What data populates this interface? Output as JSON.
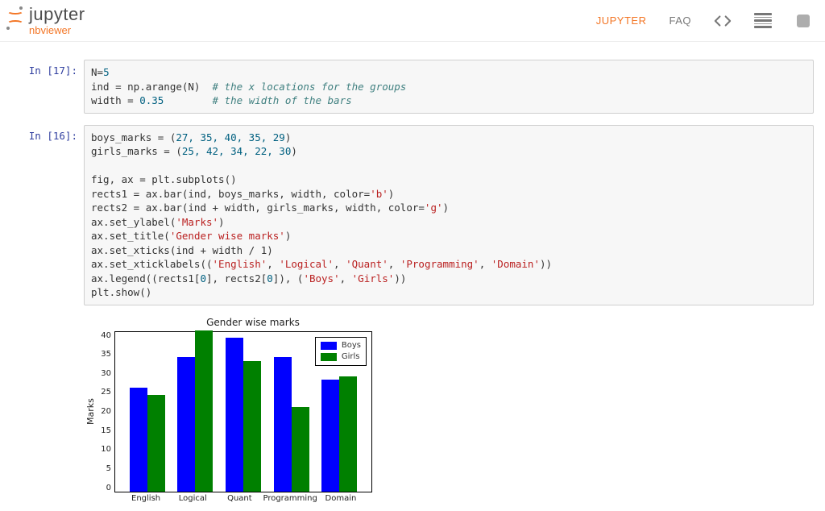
{
  "header": {
    "logo_main": "jupyter",
    "logo_sub": "nbviewer",
    "nav": {
      "jupyter": "JUPYTER",
      "faq": "FAQ"
    }
  },
  "cells": {
    "c17": {
      "prompt": "In [17]:",
      "line1_a": "N=",
      "line1_b": "5",
      "line2_a": "ind = np.arange(N)  ",
      "line2_c": "# the x locations for the groups",
      "line3_a": "width = ",
      "line3_b": "0.35",
      "line3_pad": "        ",
      "line3_c": "# the width of the bars"
    },
    "c16": {
      "prompt": "In [16]:",
      "l1": "boys_marks = (",
      "l1v": "27, 35, 40, 35, 29",
      "l1e": ")",
      "l2": "girls_marks = (",
      "l2v": "25, 42, 34, 22, 30",
      "l2e": ")",
      "l4": "fig, ax = plt.subplots()",
      "l5a": "rects1 = ax.bar(ind, boys_marks, width, color=",
      "l5s": "'b'",
      "l5e": ")",
      "l6a": "rects2 = ax.bar(ind + width, girls_marks, width, color=",
      "l6s": "'g'",
      "l6e": ")",
      "l7a": "ax.set_ylabel(",
      "l7s": "'Marks'",
      "l7e": ")",
      "l8a": "ax.set_title(",
      "l8s": "'Gender wise marks'",
      "l8e": ")",
      "l9": "ax.set_xticks(ind + width / 1)",
      "l10a": "ax.set_xticklabels((",
      "l10s1": "'English'",
      "l10c": ", ",
      "l10s2": "'Logical'",
      "l10s3": "'Quant'",
      "l10s4": "'Programming'",
      "l10s5": "'Domain'",
      "l10e": "))",
      "l11a": "ax.legend((rects1[",
      "l11n1": "0",
      "l11m": "], rects2[",
      "l11n2": "0",
      "l11m2": "]), (",
      "l11s1": "'Boys'",
      "l11s2": "'Girls'",
      "l11e": "))",
      "l12": "plt.show()"
    }
  },
  "chart_data": {
    "type": "bar",
    "title": "Gender wise marks",
    "ylabel": "Marks",
    "xlabel": "",
    "categories": [
      "English",
      "Logical",
      "Quant",
      "Programming",
      "Domain"
    ],
    "series": [
      {
        "name": "Boys",
        "color": "#0000ff",
        "values": [
          27,
          35,
          40,
          35,
          29
        ]
      },
      {
        "name": "Girls",
        "color": "#008000",
        "values": [
          25,
          42,
          34,
          22,
          30
        ]
      }
    ],
    "ylim": [
      0,
      42
    ],
    "yticks": [
      40,
      35,
      30,
      25,
      20,
      15,
      10,
      5,
      0
    ]
  }
}
